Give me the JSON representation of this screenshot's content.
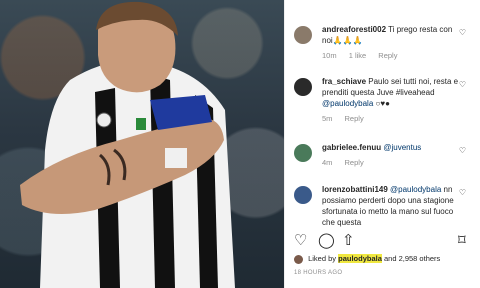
{
  "comments": [
    {
      "user": "andreaforesti002",
      "text": "Ti prego resta con noi🙏🙏🙏",
      "time": "10m",
      "likes": "1 like",
      "reply": "Reply"
    },
    {
      "user": "fra_schiave",
      "text": "Paulo sei tutti noi, resta e prenditi questa Juve #liveahead",
      "mention": "@paulodybala",
      "emoji": "○♥●",
      "time": "5m",
      "reply": "Reply"
    },
    {
      "user": "gabrielee.fenuu",
      "mention": "@juventus",
      "time": "4m",
      "reply": "Reply"
    },
    {
      "user": "lorenzobattini149",
      "mention": "@paulodybala",
      "text": "nn possiamo perderti dopo una stagione sfortunata io metto la mano sul fuoco che questa"
    }
  ],
  "likes": {
    "prefix": "Liked by",
    "user": "paulodybala",
    "suffix": "and 2,958 others"
  },
  "date": "18 HOURS AGO"
}
